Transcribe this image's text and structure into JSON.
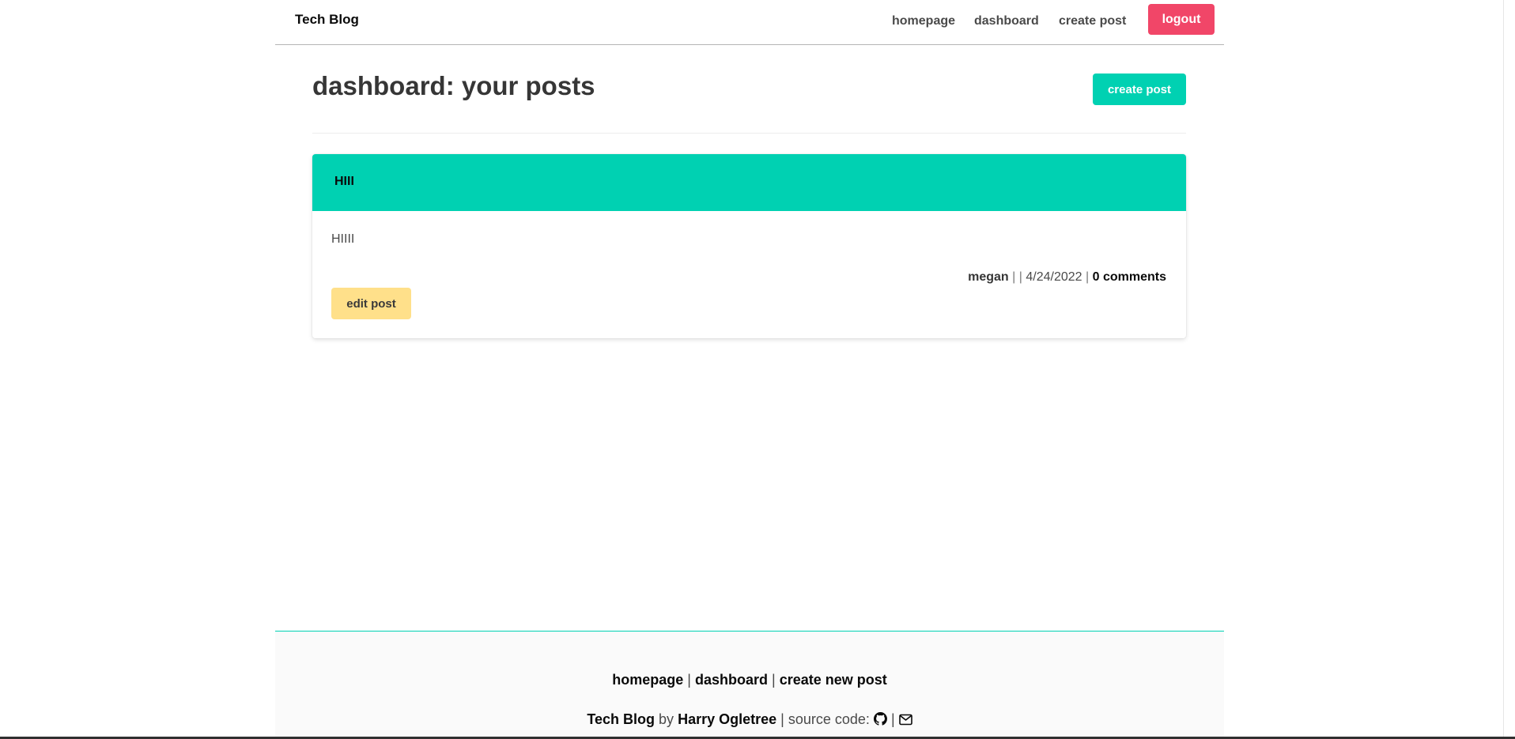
{
  "navbar": {
    "brand": "Tech Blog",
    "links": {
      "homepage": "homepage",
      "dashboard": "dashboard",
      "create_post": "create post"
    },
    "logout_label": "logout"
  },
  "header": {
    "title": "dashboard: your posts",
    "create_post_label": "create post"
  },
  "post": {
    "title": "HIII",
    "body": "HIIII",
    "author": "megan",
    "separator": "| |",
    "date": "4/24/2022",
    "date_sep": "|",
    "comments": "0 comments",
    "edit_label": "edit post"
  },
  "footer": {
    "links": {
      "homepage": "homepage",
      "dashboard": "dashboard",
      "create_new_post": "create new post"
    },
    "link_sep": "|",
    "credit": {
      "site": "Tech Blog",
      "by": "by",
      "author": "Harry Ogletree",
      "source_label": "| source code:",
      "sep": "|"
    },
    "icons": [
      "github-icon",
      "envelope-icon"
    ]
  },
  "colors": {
    "primary": "#00d1b2",
    "danger": "#f14668",
    "warning": "#ffe08a",
    "footer_bg": "#fafafa"
  }
}
